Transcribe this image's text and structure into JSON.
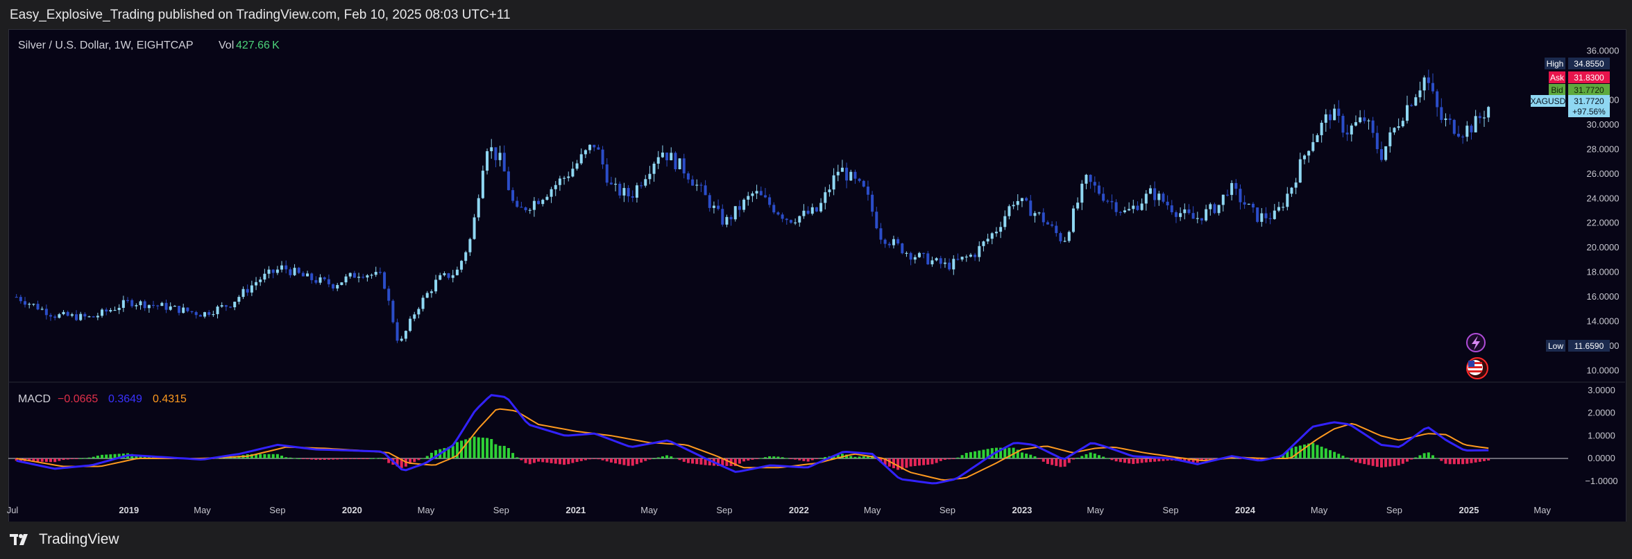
{
  "header": {
    "attribution": "Easy_Explosive_Trading published on TradingView.com, Feb 10, 2025 08:03 UTC+11"
  },
  "legend": {
    "symbol": "Silver / U.S. Dollar, 1W, EIGHTCAP",
    "vol_label": "Vol",
    "vol_value": "427.66 K"
  },
  "macd_legend": {
    "label": "MACD",
    "histogram": "−0.0665",
    "macd": "0.3649",
    "signal": "0.4315"
  },
  "price_axis": {
    "ticks": [
      "36.0000",
      "32.0000",
      "30.0000",
      "28.0000",
      "26.0000",
      "24.0000",
      "22.0000",
      "20.0000",
      "18.0000",
      "16.0000",
      "14.0000",
      "12.0000",
      "10.0000"
    ],
    "high_label": "High",
    "high_value": "34.8550",
    "ask_label": "Ask",
    "ask_value": "31.8300",
    "bid_label": "Bid",
    "bid_value": "31.7720",
    "symbol_tag": "XAGUSD",
    "last_value": "31.7720",
    "change": "+97.56%",
    "low_label": "Low",
    "low_value": "11.6590"
  },
  "macd_axis": {
    "ticks": [
      "3.0000",
      "2.0000",
      "1.0000",
      "0.0000",
      "−1.0000"
    ]
  },
  "time_axis": {
    "labels": [
      "Jul",
      "2019",
      "May",
      "Sep",
      "2020",
      "May",
      "Sep",
      "2021",
      "May",
      "Sep",
      "2022",
      "May",
      "Sep",
      "2023",
      "May",
      "Sep",
      "2024",
      "May",
      "Sep",
      "2025",
      "May"
    ]
  },
  "colors": {
    "background": "#070516",
    "candle_up": "#8fd7f2",
    "candle_down": "#2b4dc8",
    "macd_line": "#3322ff",
    "signal_line": "#ff9a1f",
    "hist_pos": "#33e83a",
    "hist_neg": "#ff2a5f",
    "ask_badge": "#e8144c",
    "bid_badge": "#5ea93e",
    "high_low_badge": "#1b2a4e",
    "symbol_badge": "#8fd7f2"
  },
  "footer": {
    "brand": "TradingView",
    "logo_icon": "tradingview-logo-icon"
  },
  "icons": {
    "lightning": "lightning-icon",
    "flag": "us-flag-icon"
  },
  "chart_data": {
    "type": "candlestick",
    "title": "Silver / U.S. Dollar, 1W, EIGHTCAP",
    "price_range": [
      9,
      37
    ],
    "price_series": [
      [
        "2018-07-01",
        16.0
      ],
      [
        "2018-09-01",
        14.5
      ],
      [
        "2018-11-01",
        14.3
      ],
      [
        "2019-01-01",
        15.6
      ],
      [
        "2019-03-01",
        15.2
      ],
      [
        "2019-05-01",
        14.6
      ],
      [
        "2019-06-15",
        15.4
      ],
      [
        "2019-08-01",
        17.4
      ],
      [
        "2019-09-10",
        18.4
      ],
      [
        "2019-10-15",
        17.6
      ],
      [
        "2019-12-01",
        17.0
      ],
      [
        "2020-01-15",
        18.0
      ],
      [
        "2020-02-20",
        17.6
      ],
      [
        "2020-03-18",
        12.0
      ],
      [
        "2020-04-15",
        15.0
      ],
      [
        "2020-05-20",
        17.4
      ],
      [
        "2020-06-20",
        18.0
      ],
      [
        "2020-07-15",
        21.0
      ],
      [
        "2020-08-07",
        28.5
      ],
      [
        "2020-09-01",
        27.0
      ],
      [
        "2020-09-25",
        22.8
      ],
      [
        "2020-11-01",
        24.0
      ],
      [
        "2020-12-15",
        25.8
      ],
      [
        "2021-02-01",
        28.5
      ],
      [
        "2021-03-01",
        24.8
      ],
      [
        "2021-04-01",
        24.2
      ],
      [
        "2021-05-20",
        28.0
      ],
      [
        "2021-07-01",
        26.2
      ],
      [
        "2021-09-01",
        22.0
      ],
      [
        "2021-10-20",
        24.5
      ],
      [
        "2021-12-15",
        22.3
      ],
      [
        "2022-02-01",
        23.0
      ],
      [
        "2022-03-08",
        26.5
      ],
      [
        "2022-04-20",
        24.5
      ],
      [
        "2022-05-15",
        21.0
      ],
      [
        "2022-07-01",
        19.5
      ],
      [
        "2022-09-01",
        18.5
      ],
      [
        "2022-10-15",
        19.5
      ],
      [
        "2022-11-20",
        21.5
      ],
      [
        "2022-12-20",
        24.0
      ],
      [
        "2023-02-01",
        22.5
      ],
      [
        "2023-03-10",
        20.5
      ],
      [
        "2023-04-15",
        25.5
      ],
      [
        "2023-05-20",
        24.0
      ],
      [
        "2023-06-20",
        22.8
      ],
      [
        "2023-08-01",
        24.5
      ],
      [
        "2023-09-10",
        23.0
      ],
      [
        "2023-10-10",
        22.3
      ],
      [
        "2023-11-20",
        23.5
      ],
      [
        "2023-12-05",
        25.0
      ],
      [
        "2024-01-20",
        22.5
      ],
      [
        "2024-02-20",
        22.6
      ],
      [
        "2024-03-15",
        24.8
      ],
      [
        "2024-04-15",
        28.5
      ],
      [
        "2024-05-20",
        31.0
      ],
      [
        "2024-06-15",
        29.5
      ],
      [
        "2024-07-15",
        30.5
      ],
      [
        "2024-08-10",
        27.5
      ],
      [
        "2024-09-15",
        31.0
      ],
      [
        "2024-10-22",
        34.0
      ],
      [
        "2024-11-15",
        30.5
      ],
      [
        "2024-12-20",
        29.5
      ],
      [
        "2025-01-10",
        30.0
      ],
      [
        "2025-02-07",
        31.8
      ]
    ],
    "macd_range": [
      -1.5,
      3.1
    ],
    "macd_series": [
      [
        "2018-07-01",
        -0.1
      ],
      [
        "2018-09-01",
        -0.45
      ],
      [
        "2018-11-01",
        -0.3
      ],
      [
        "2019-01-01",
        0.15
      ],
      [
        "2019-05-01",
        -0.05
      ],
      [
        "2019-07-01",
        0.2
      ],
      [
        "2019-09-01",
        0.6
      ],
      [
        "2019-11-01",
        0.4
      ],
      [
        "2020-01-01",
        0.35
      ],
      [
        "2020-02-20",
        0.3
      ],
      [
        "2020-03-25",
        -0.55
      ],
      [
        "2020-05-01",
        -0.2
      ],
      [
        "2020-06-15",
        0.6
      ],
      [
        "2020-07-20",
        2.1
      ],
      [
        "2020-08-15",
        2.8
      ],
      [
        "2020-09-10",
        2.7
      ],
      [
        "2020-10-15",
        1.5
      ],
      [
        "2020-12-15",
        1.0
      ],
      [
        "2021-02-01",
        1.1
      ],
      [
        "2021-04-01",
        0.5
      ],
      [
        "2021-06-01",
        0.8
      ],
      [
        "2021-08-01",
        0.0
      ],
      [
        "2021-09-20",
        -0.6
      ],
      [
        "2021-11-15",
        -0.3
      ],
      [
        "2022-01-15",
        -0.4
      ],
      [
        "2022-03-15",
        0.3
      ],
      [
        "2022-05-01",
        0.2
      ],
      [
        "2022-06-15",
        -0.9
      ],
      [
        "2022-08-10",
        -1.1
      ],
      [
        "2022-09-15",
        -0.9
      ],
      [
        "2022-11-15",
        0.2
      ],
      [
        "2022-12-20",
        0.7
      ],
      [
        "2023-01-20",
        0.6
      ],
      [
        "2023-03-10",
        -0.05
      ],
      [
        "2023-04-25",
        0.7
      ],
      [
        "2023-05-20",
        0.5
      ],
      [
        "2023-07-01",
        0.1
      ],
      [
        "2023-09-01",
        0.0
      ],
      [
        "2023-10-15",
        -0.25
      ],
      [
        "2023-12-10",
        0.1
      ],
      [
        "2024-01-25",
        -0.1
      ],
      [
        "2024-03-01",
        0.1
      ],
      [
        "2024-04-20",
        1.4
      ],
      [
        "2024-05-25",
        1.6
      ],
      [
        "2024-06-20",
        1.5
      ],
      [
        "2024-08-10",
        0.6
      ],
      [
        "2024-09-10",
        0.5
      ],
      [
        "2024-10-25",
        1.4
      ],
      [
        "2024-11-25",
        0.8
      ],
      [
        "2024-12-25",
        0.35
      ],
      [
        "2025-02-07",
        0.36
      ]
    ],
    "signal_series": [
      [
        "2018-07-01",
        0.0
      ],
      [
        "2018-09-15",
        -0.35
      ],
      [
        "2018-11-15",
        -0.35
      ],
      [
        "2019-01-15",
        0.0
      ],
      [
        "2019-05-01",
        0.0
      ],
      [
        "2019-07-15",
        0.1
      ],
      [
        "2019-09-15",
        0.5
      ],
      [
        "2019-11-15",
        0.45
      ],
      [
        "2020-01-15",
        0.35
      ],
      [
        "2020-03-01",
        0.25
      ],
      [
        "2020-04-01",
        -0.2
      ],
      [
        "2020-05-15",
        -0.3
      ],
      [
        "2020-06-20",
        0.1
      ],
      [
        "2020-07-25",
        1.3
      ],
      [
        "2020-08-25",
        2.2
      ],
      [
        "2020-09-25",
        2.1
      ],
      [
        "2020-11-01",
        1.5
      ],
      [
        "2021-01-01",
        1.2
      ],
      [
        "2021-03-01",
        1.0
      ],
      [
        "2021-05-01",
        0.7
      ],
      [
        "2021-07-01",
        0.6
      ],
      [
        "2021-08-20",
        0.1
      ],
      [
        "2021-10-01",
        -0.4
      ],
      [
        "2021-12-01",
        -0.4
      ],
      [
        "2022-02-01",
        -0.2
      ],
      [
        "2022-04-01",
        0.2
      ],
      [
        "2022-05-20",
        0.0
      ],
      [
        "2022-07-01",
        -0.6
      ],
      [
        "2022-08-25",
        -0.95
      ],
      [
        "2022-10-01",
        -0.85
      ],
      [
        "2022-11-20",
        -0.2
      ],
      [
        "2023-01-01",
        0.4
      ],
      [
        "2023-02-10",
        0.55
      ],
      [
        "2023-03-25",
        0.25
      ],
      [
        "2023-05-01",
        0.45
      ],
      [
        "2023-06-01",
        0.5
      ],
      [
        "2023-07-20",
        0.25
      ],
      [
        "2023-09-10",
        0.05
      ],
      [
        "2023-10-25",
        -0.1
      ],
      [
        "2023-12-20",
        0.05
      ],
      [
        "2024-02-01",
        0.0
      ],
      [
        "2024-03-15",
        0.0
      ],
      [
        "2024-04-25",
        0.8
      ],
      [
        "2024-05-25",
        1.3
      ],
      [
        "2024-06-25",
        1.55
      ],
      [
        "2024-08-10",
        1.0
      ],
      [
        "2024-09-10",
        0.8
      ],
      [
        "2024-10-25",
        1.1
      ],
      [
        "2024-11-25",
        1.05
      ],
      [
        "2024-12-25",
        0.6
      ],
      [
        "2025-02-07",
        0.43
      ]
    ]
  }
}
